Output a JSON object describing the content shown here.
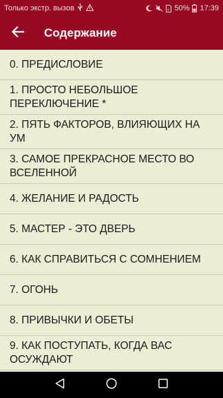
{
  "status_bar": {
    "carrier_text": "Только экстр. вызов",
    "battery": "50%",
    "time": "17:39"
  },
  "app_bar": {
    "title": "Содержание",
    "back_icon": "arrow-left-icon"
  },
  "items": [
    {
      "label": "0. ПРЕДИСЛОВИЕ"
    },
    {
      "label": "1. ПРОСТО НЕБОЛЬШОЕ ПЕРЕКЛЮЧЕНИЕ *"
    },
    {
      "label": "2. ПЯТЬ ФАКТОРОВ, ВЛИЯЮЩИХ НА УМ"
    },
    {
      "label": "3. САМОЕ ПРЕКРАСНОЕ МЕСТО ВО ВСЕЛЕННОЙ"
    },
    {
      "label": "4. ЖЕЛАНИЕ И РАДОСТЬ"
    },
    {
      "label": "5. МАСТЕР - ЭТО ДВЕРЬ"
    },
    {
      "label": "6. КАК СПРАВИТЬСЯ С СОМНЕНИЕМ"
    },
    {
      "label": "7. ОГОНЬ"
    },
    {
      "label": "8. ПРИВЫЧКИ И ОБЕТЫ"
    },
    {
      "label": "9. КАК ПОСТУПАТЬ, КОГДА ВАС ОСУЖДАЮТ"
    }
  ],
  "nav_bar": {
    "back_icon": "triangle-back-icon",
    "home_icon": "circle-home-icon",
    "recents_icon": "square-recents-icon"
  },
  "colors": {
    "primary": "#980a23",
    "background": "#efecd6",
    "divider": "#cfcbb2"
  }
}
